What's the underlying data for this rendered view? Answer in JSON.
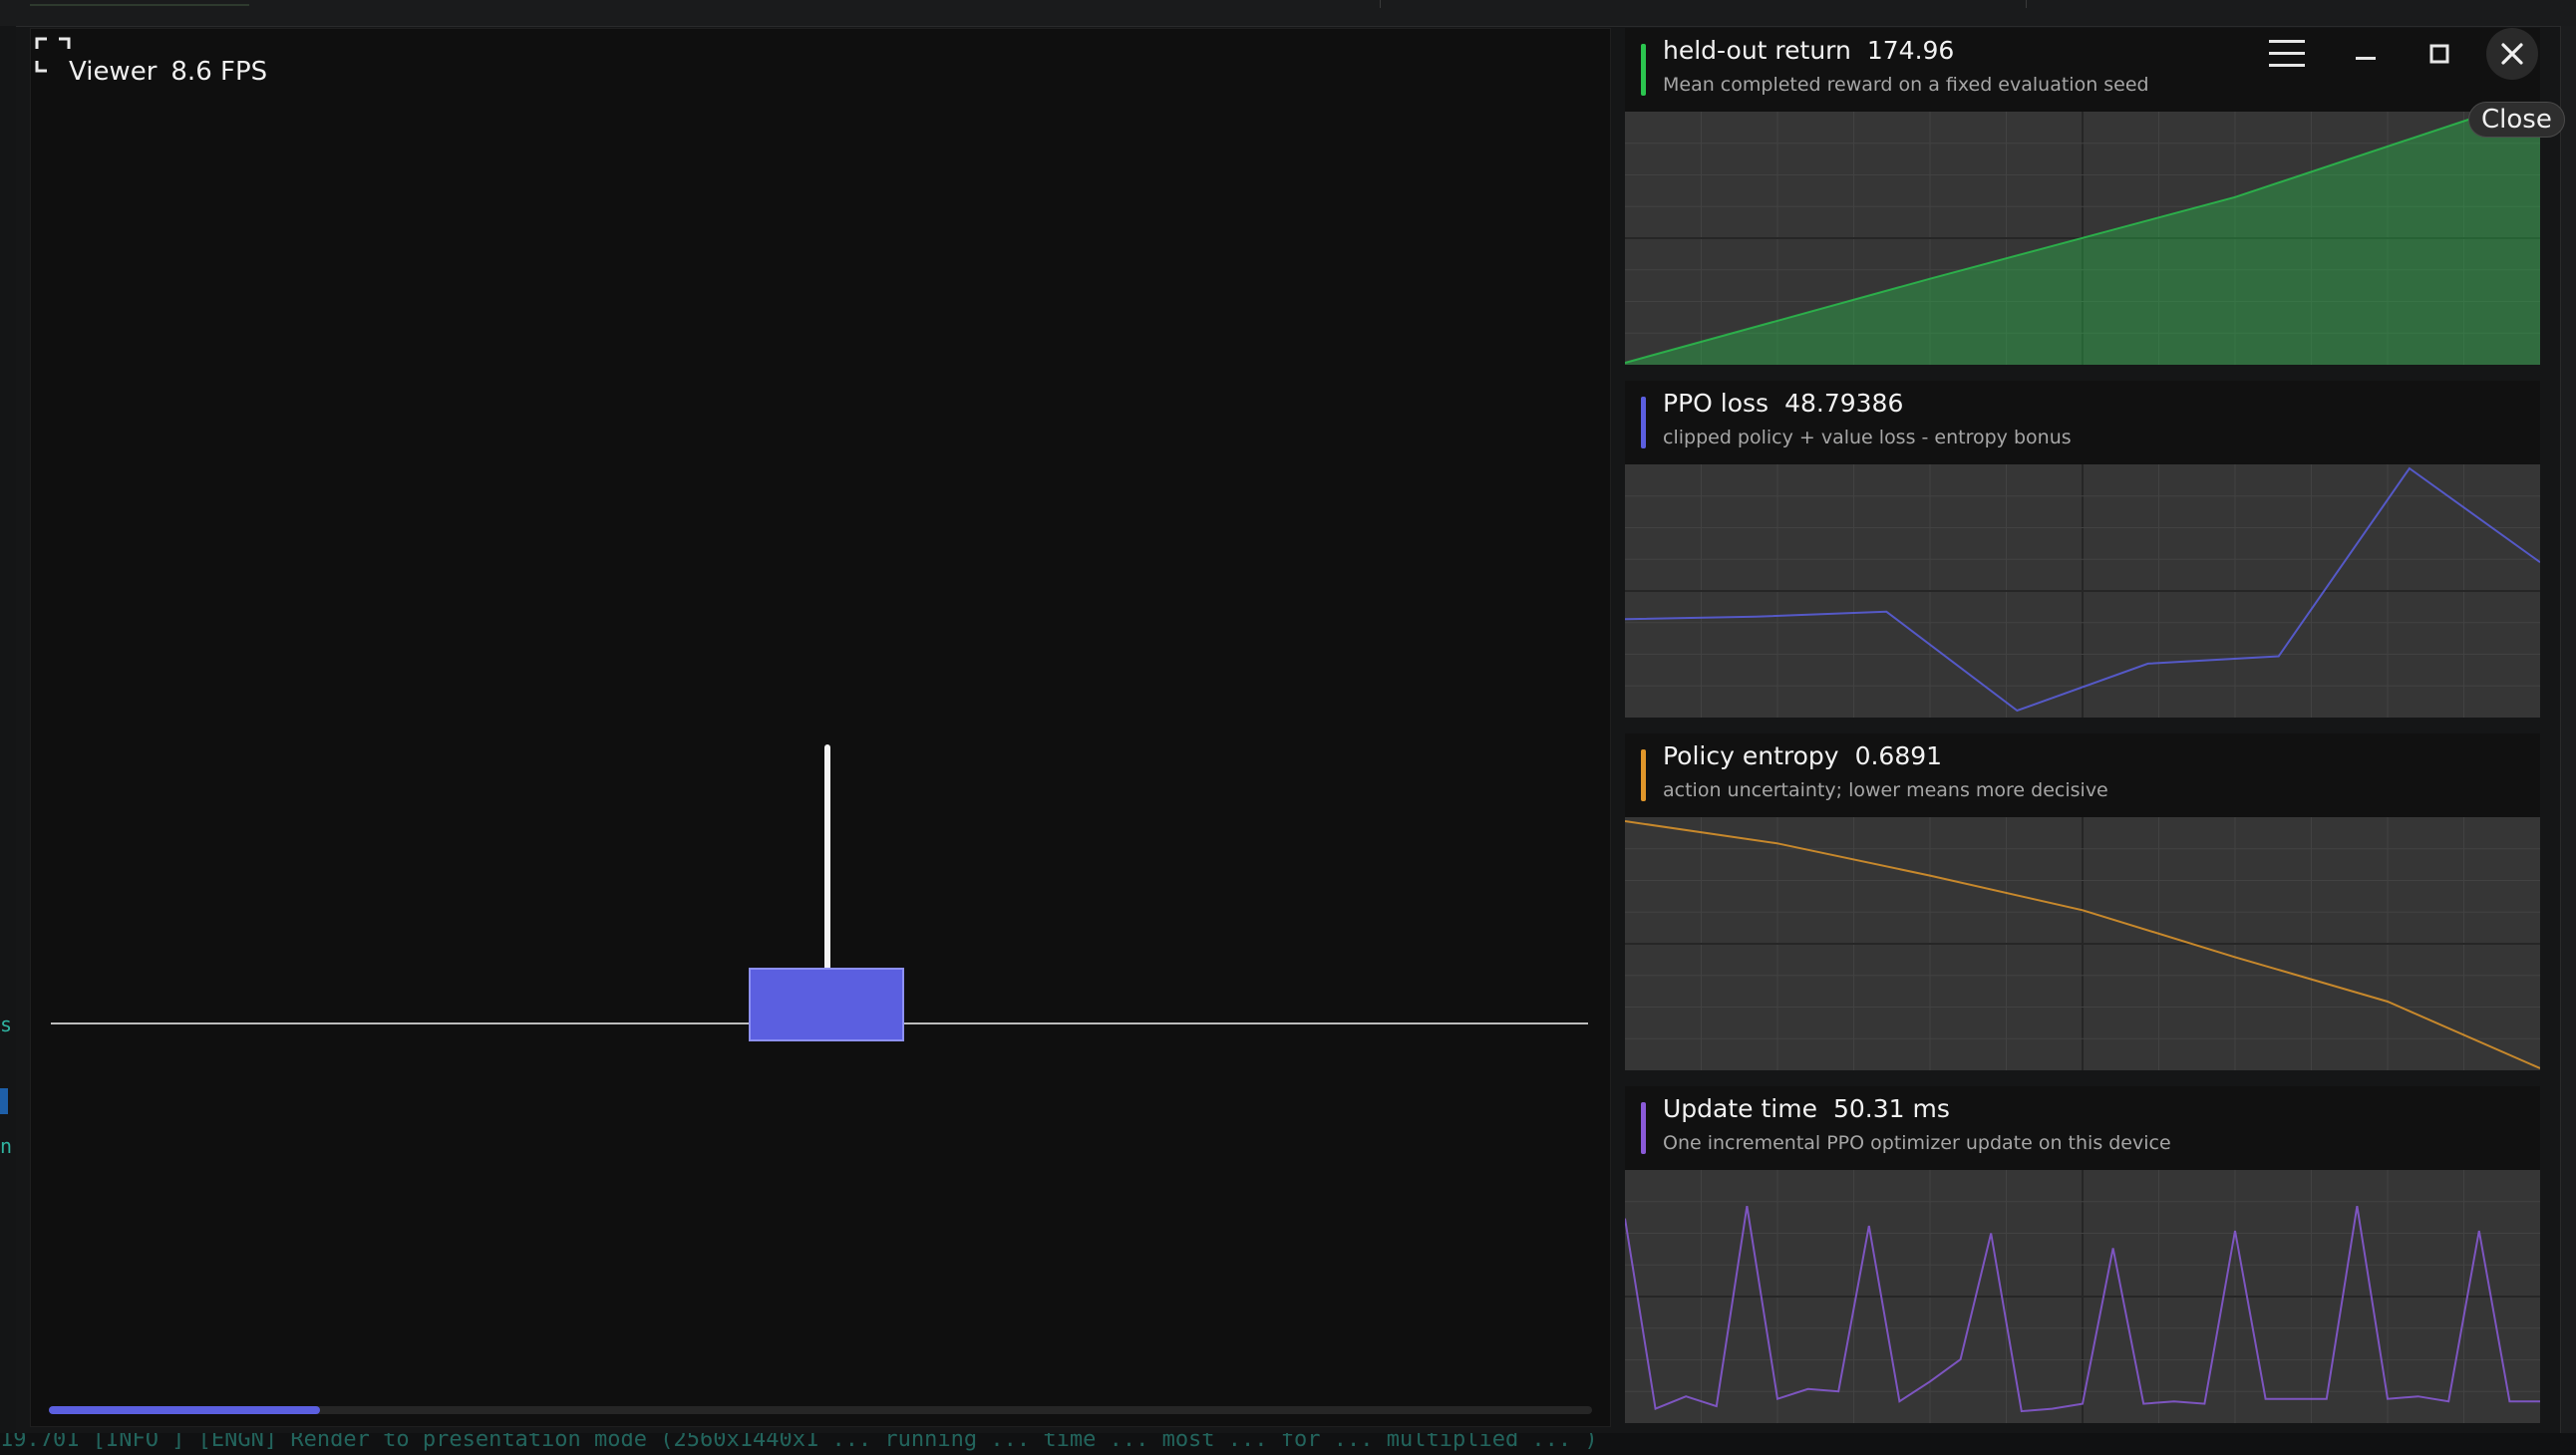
{
  "viewer": {
    "title": "Viewer",
    "fps": "8.6 FPS",
    "progress_fraction": 0.176,
    "pole_color": "#f4f4f4",
    "cart_color": "#5b5fe0"
  },
  "window": {
    "menu_icon": "hamburger-menu-icon",
    "minimize_icon": "minimize-icon",
    "maximize_icon": "maximize-icon",
    "close_icon": "close-icon",
    "close_tooltip": "Close"
  },
  "charts": [
    {
      "title": "held-out return",
      "value": "174.96",
      "subtitle": "Mean completed reward on a fixed evaluation seed",
      "color": "#2bc54f",
      "fill": true,
      "series": [
        0,
        0.34,
        0.67,
        1.0
      ]
    },
    {
      "title": "PPO loss",
      "value": "48.79386",
      "subtitle": "clipped policy + value loss - entropy bonus",
      "color": "#5b5fe0",
      "fill": false,
      "series": [
        0.39,
        0.4,
        0.42,
        0.02,
        0.21,
        0.24,
        1.0,
        0.62
      ]
    },
    {
      "title": "Policy entropy",
      "value": "0.6891",
      "subtitle": "action uncertainty; lower means more decisive",
      "color": "#e0962a",
      "fill": false,
      "series": [
        1.0,
        0.91,
        0.78,
        0.64,
        0.45,
        0.27,
        0.0
      ]
    },
    {
      "title": "Update time",
      "value": "50.31 ms",
      "subtitle": "One incremental PPO optimizer update on this device",
      "color": "#8a5ad8",
      "fill": false,
      "series": [
        0.82,
        0.05,
        0.1,
        0.06,
        0.87,
        0.09,
        0.13,
        0.12,
        0.79,
        0.08,
        0.16,
        0.25,
        0.76,
        0.04,
        0.05,
        0.07,
        0.7,
        0.07,
        0.08,
        0.07,
        0.77,
        0.09,
        0.09,
        0.09,
        0.87,
        0.09,
        0.1,
        0.08,
        0.77,
        0.08,
        0.08
      ]
    }
  ],
  "background": {
    "log_line": "19.701 [INFO ] [ENGN]     Render to presentation mode (2560x1440x1 ...  running ...  time ... most ... for  ...  multiplied ... )"
  }
}
